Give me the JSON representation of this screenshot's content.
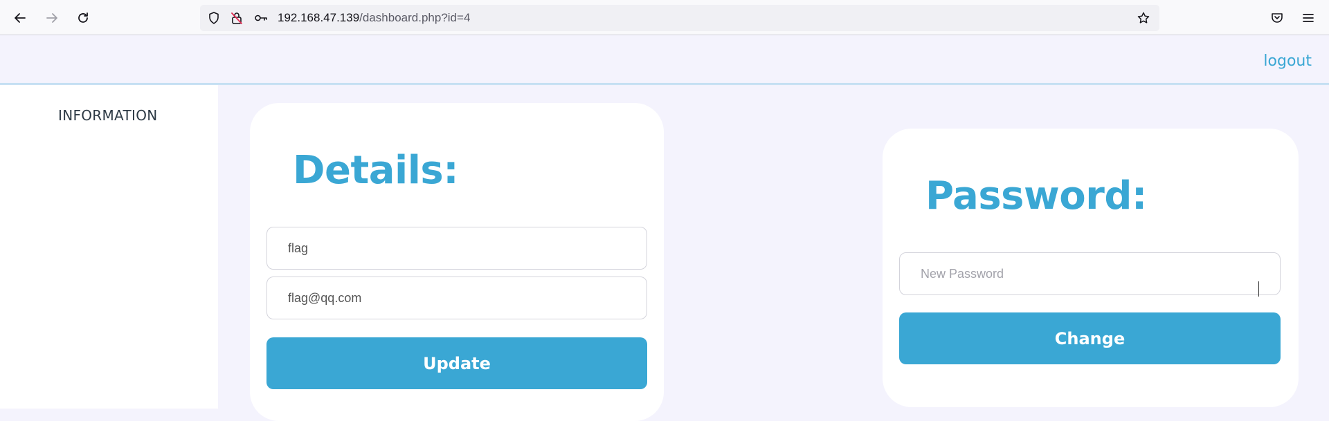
{
  "browser": {
    "url_host": "192.168.47.139",
    "url_path": "/dashboard.php?id=4",
    "icons": [
      "back-icon",
      "forward-icon",
      "reload-icon",
      "shield-icon",
      "insecure-lock-icon",
      "key-icon",
      "bookmark-star-icon",
      "pocket-icon",
      "menu-icon"
    ]
  },
  "header": {
    "logout_label": "logout"
  },
  "sidebar": {
    "items": [
      {
        "label": "INFORMATION"
      }
    ]
  },
  "details": {
    "title": "Details:",
    "name_value": "flag",
    "email_value": "flag@qq.com",
    "update_label": "Update"
  },
  "password": {
    "title": "Password:",
    "new_password_placeholder": "New Password",
    "change_label": "Change"
  },
  "colors": {
    "accent": "#3aa7d4",
    "page_bg": "#f4f3fd",
    "card_bg": "#ffffff"
  }
}
